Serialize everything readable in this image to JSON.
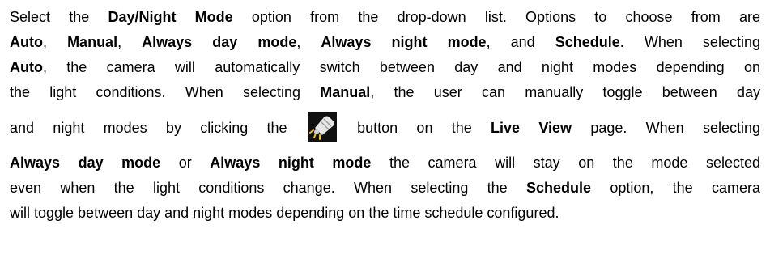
{
  "paragraph": {
    "l1": {
      "t1": "Select the ",
      "b1": "Day/Night Mode",
      "t2": " option from the drop-down list. Options to choose from are"
    },
    "l2": {
      "b1": "Auto",
      "t1": ", ",
      "b2": "Manual",
      "t2": ", ",
      "b3": "Always day mode",
      "t3": ", ",
      "b4": "Always night mode",
      "t4": ", and ",
      "b5": "Schedule",
      "t5": ". When selecting"
    },
    "l3": {
      "b1": "Auto",
      "t1": ", the camera will automatically switch between day and night modes depending on"
    },
    "l4": {
      "t1": "the light conditions. When selecting ",
      "b1": "Manual",
      "t2": ", the user can manually toggle between day"
    },
    "l5": {
      "t1": "and night modes by clicking the ",
      "t2": " button on the ",
      "b1": "Live View",
      "t3": " page. When selecting"
    },
    "l6": {
      "b1": "Always day mode",
      "t1": " or ",
      "b2": "Always night mode",
      "t2": " the camera will stay on the mode selected"
    },
    "l7": {
      "t1": "even when the light conditions change. When selecting the ",
      "b1": "Schedule",
      "t2": " option, the camera"
    },
    "l8": {
      "t1": "will toggle between day and night modes depending on the time schedule configured."
    }
  },
  "inline_icon": {
    "name": "day-night-toggle-icon",
    "background": "#111111",
    "lamp_color": "#e6e6e6",
    "rays_color": "#f2c400"
  }
}
